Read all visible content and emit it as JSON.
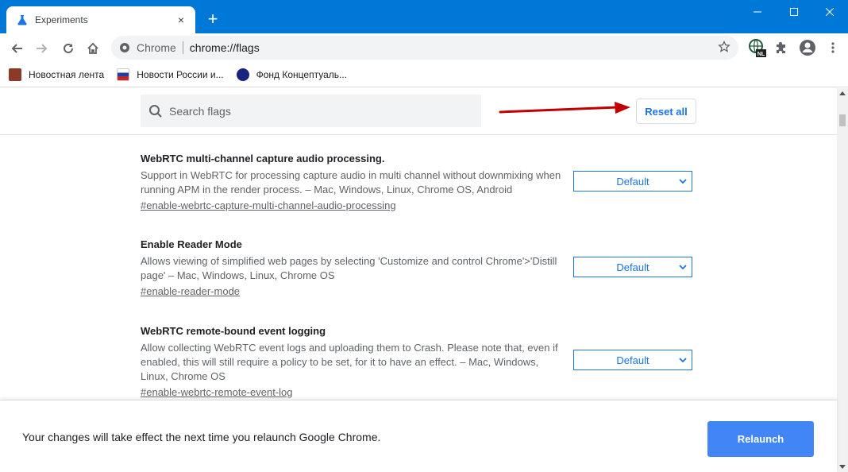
{
  "tab": {
    "title": "Experiments",
    "close_icon": "×"
  },
  "newtab_label": "+",
  "window_controls": {
    "minimize": "—",
    "maximize": "☐",
    "close": "✕"
  },
  "omnibox": {
    "site": "Chrome",
    "url": "chrome://flags"
  },
  "extensions": {
    "badge": "NL"
  },
  "bookmarks": [
    {
      "label": "Новостная лента",
      "icon_color": "#8b3a2a"
    },
    {
      "label": "Новости России и...",
      "icon_color": "#c62828"
    },
    {
      "label": "Фонд Концептуаль...",
      "icon_color": "#1a237e"
    }
  ],
  "search": {
    "placeholder": "Search flags"
  },
  "reset_label": "Reset all",
  "flags": [
    {
      "title": "WebRTC multi-channel capture audio processing.",
      "description": "Support in WebRTC for processing capture audio in multi channel without downmixing when running APM in the render process. – Mac, Windows, Linux, Chrome OS, Android",
      "link": "#enable-webrtc-capture-multi-channel-audio-processing",
      "value": "Default"
    },
    {
      "title": "Enable Reader Mode",
      "description": "Allows viewing of simplified web pages by selecting 'Customize and control Chrome'>'Distill page' – Mac, Windows, Linux, Chrome OS",
      "link": "#enable-reader-mode",
      "value": "Default"
    },
    {
      "title": "WebRTC remote-bound event logging",
      "description": "Allow collecting WebRTC event logs and uploading them to Crash. Please note that, even if enabled, this will still require a policy to be set, for it to have an effect. – Mac, Windows, Linux, Chrome OS",
      "link": "#enable-webrtc-remote-event-log",
      "value": "Default"
    }
  ],
  "footer": {
    "message": "Your changes will take effect the next time you relaunch Google Chrome.",
    "relaunch_label": "Relaunch"
  },
  "colors": {
    "titlebar": "#0078d7",
    "accent": "#1a73e8",
    "relaunch": "#4285f4",
    "annotation_arrow": "#c00000"
  }
}
